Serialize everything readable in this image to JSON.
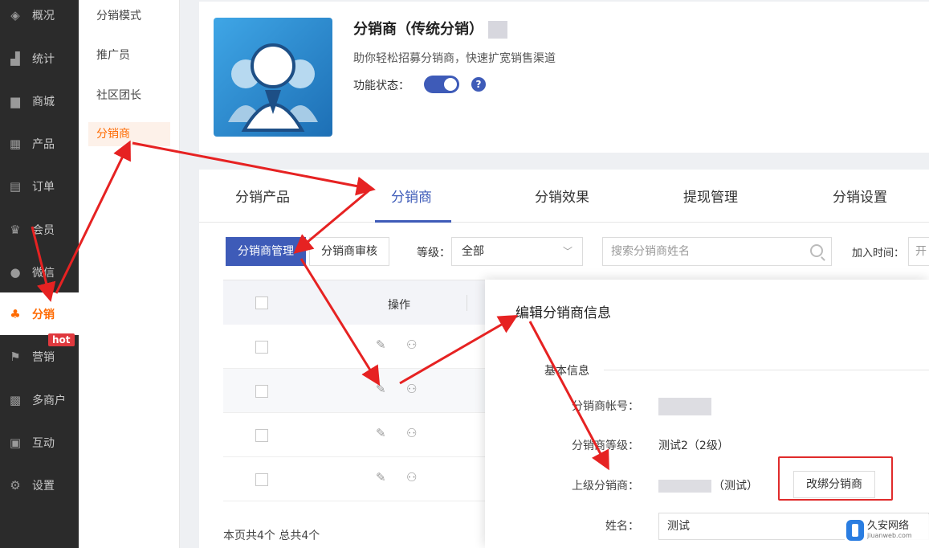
{
  "sidebar": {
    "items": [
      {
        "label": "概况",
        "icon": "layers-icon"
      },
      {
        "label": "统计",
        "icon": "chart-icon"
      },
      {
        "label": "商城",
        "icon": "store-icon"
      },
      {
        "label": "产品",
        "icon": "grid-icon"
      },
      {
        "label": "订单",
        "icon": "order-icon"
      },
      {
        "label": "会员",
        "icon": "crown-icon"
      },
      {
        "label": "微信",
        "icon": "wechat-icon"
      },
      {
        "label": "分销",
        "icon": "distribution-icon"
      },
      {
        "label": "营销",
        "icon": "flag-icon"
      },
      {
        "label": "多商户",
        "icon": "merchant-icon"
      },
      {
        "label": "互动",
        "icon": "interact-icon"
      },
      {
        "label": "设置",
        "icon": "gear-icon"
      }
    ],
    "hot_badge": "hot"
  },
  "submenu": {
    "items": [
      "分销模式",
      "推广员",
      "社区团长",
      "分销商"
    ]
  },
  "header": {
    "title": "分销商（传统分销）",
    "description": "助你轻松招募分销商，快速扩宽销售渠道",
    "status_label": "功能状态：",
    "help_icon": "?"
  },
  "tabs": [
    "分销产品",
    "分销商",
    "分销效果",
    "提现管理",
    "分销设置"
  ],
  "toolbar": {
    "manage_btn": "分销商管理",
    "review_btn": "分销商审核",
    "level_label": "等级：",
    "level_value": "全部",
    "search_placeholder": "搜索分销商姓名",
    "join_time_label": "加入时间：",
    "date_placeholder": "开"
  },
  "table": {
    "op_header": "操作"
  },
  "footer": {
    "summary": "本页共4个  总共4个"
  },
  "modal": {
    "title": "编辑分销商信息",
    "section": "基本信息",
    "account_label": "分销商帐号：",
    "level_label": "分销商等级：",
    "level_value": "测试2（2级）",
    "parent_label": "上级分销商：",
    "parent_value": "（测试）",
    "rebind_btn": "改绑分销商",
    "name_label": "姓名：",
    "name_value": "测试"
  },
  "watermark": {
    "title": "久安网络",
    "sub": "jiuanweb.com"
  },
  "colors": {
    "primary": "#3e5bb8",
    "active_orange": "#ff6a00",
    "annotation_red": "#e02b2b"
  }
}
